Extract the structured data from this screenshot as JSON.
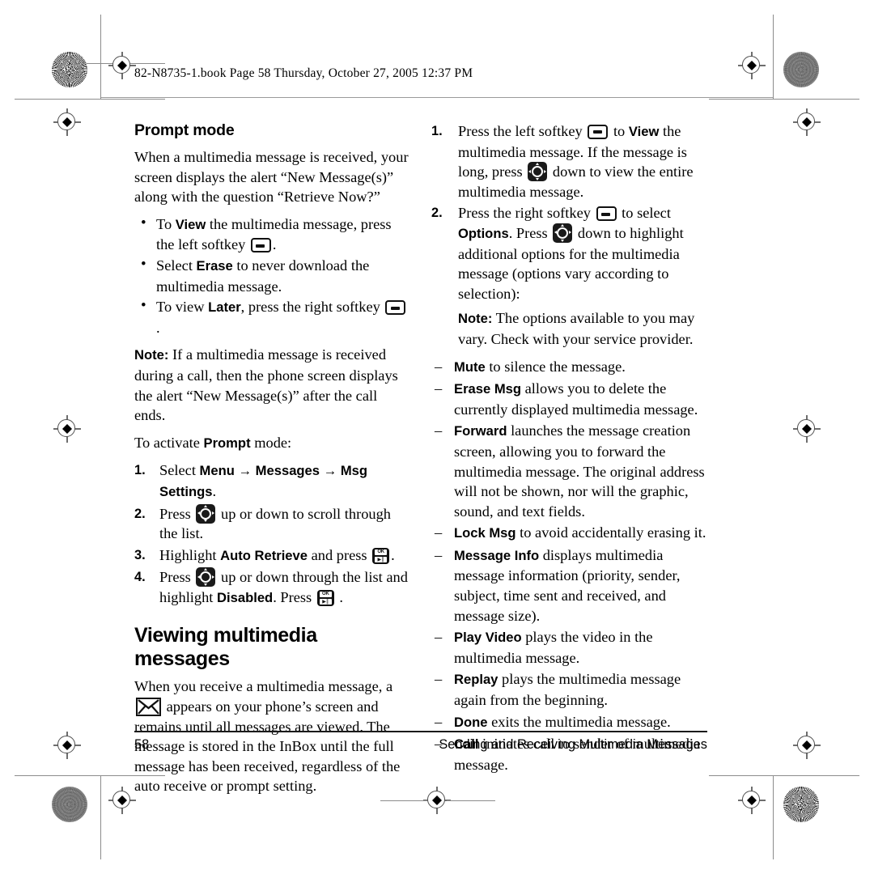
{
  "page": {
    "header_text": "82-N8735-1.book  Page 58  Thursday, October 27, 2005  12:37 PM",
    "page_number": "58",
    "footer_title": "Sending and Receiving Multimedia Messages"
  },
  "left_column": {
    "heading": "Prompt mode",
    "intro": "When a multimedia message is received, your screen displays the alert “New Message(s)” along with the question “Retrieve Now?”",
    "bullets": [
      {
        "pre": "To ",
        "bold": "View",
        "post": " the multimedia message, press the left softkey ",
        "icon": "softkey-icon",
        "tail": "."
      },
      {
        "pre": "Select ",
        "bold": "Erase",
        "post": " to never download the multimedia message.",
        "icon": "",
        "tail": ""
      },
      {
        "pre": "To view ",
        "bold": "Later",
        "post": ", press the right softkey ",
        "icon": "softkey-icon",
        "tail": "."
      }
    ],
    "note_label": "Note:",
    "note_text": " If a multimedia message is received during a call, then the phone screen displays the alert “New Message(s)” after the call ends.",
    "activate_pre": "To activate ",
    "activate_bold": "Prompt",
    "activate_post": " mode:",
    "steps": [
      {
        "pre": "Select ",
        "bold": "Menu → Messages → Msg Settings",
        "post": ".",
        "icon": "",
        "mid": "",
        "bold2": "",
        "post2": "",
        "icon2": "",
        "tail": ""
      },
      {
        "pre": "Press ",
        "bold": "",
        "post": "",
        "icon": "nav-key-icon",
        "mid": " up or down to scroll through the list.",
        "bold2": "",
        "post2": "",
        "icon2": "",
        "tail": ""
      },
      {
        "pre": "Highlight ",
        "bold": "Auto Retrieve",
        "post": " and press ",
        "icon": "ok-key-icon",
        "mid": "",
        "bold2": "",
        "post2": "",
        "icon2": "",
        "tail": "."
      },
      {
        "pre": "Press ",
        "bold": "",
        "post": "",
        "icon": "nav-key-icon",
        "mid": " up or down through the list and highlight ",
        "bold2": "Disabled",
        "post2": ". Press ",
        "icon2": "ok-key-icon",
        "tail": " ."
      }
    ],
    "heading2": "Viewing multimedia messages",
    "viewing_pre": "When you receive a multimedia message, a ",
    "viewing_icon": "envelope-icon",
    "viewing_post": " appears on your phone’s screen and remains until all messages are viewed. The message is stored in the InBox until the full message has been received, regardless of the auto receive or prompt setting."
  },
  "right_column": {
    "steps": [
      {
        "pre": "Press the left softkey ",
        "icon": "softkey-icon",
        "mid": " to ",
        "bold": "View",
        "post": " the multimedia message. If the message is long, press ",
        "icon2": "nav-key-icon",
        "tail": " down to view the entire multimedia message."
      },
      {
        "pre": "Press the right softkey ",
        "icon": "softkey-icon",
        "mid": " to select ",
        "bold": "Options",
        "post": ". Press ",
        "icon2": "nav-key-icon",
        "tail": " down to highlight additional options for the multimedia message (options vary according to selection):"
      }
    ],
    "note_label": "Note:",
    "note_text": " The options available to you may vary. Check with your service provider.",
    "options": [
      {
        "bold": "Mute",
        "text": " to silence the message."
      },
      {
        "bold": "Erase Msg",
        "text": " allows you to delete the currently displayed multimedia message."
      },
      {
        "bold": "Forward",
        "text": " launches the message creation screen, allowing you to forward the multimedia message. The original address will not be shown, nor will the graphic, sound, and text fields."
      },
      {
        "bold": "Lock Msg",
        "text": " to avoid accidentally erasing it."
      },
      {
        "bold": "Message Info",
        "text": " displays multimedia message information (priority, sender, subject, time sent and received, and message size)."
      },
      {
        "bold": "Play Video",
        "text": " plays the video in the multimedia message."
      },
      {
        "bold": "Replay",
        "text": " plays the multimedia message again from the beginning."
      },
      {
        "bold": "Done",
        "text": " exits the multimedia message."
      },
      {
        "bold": "Call",
        "text": " initiates call to sender of multimedia message."
      }
    ]
  }
}
